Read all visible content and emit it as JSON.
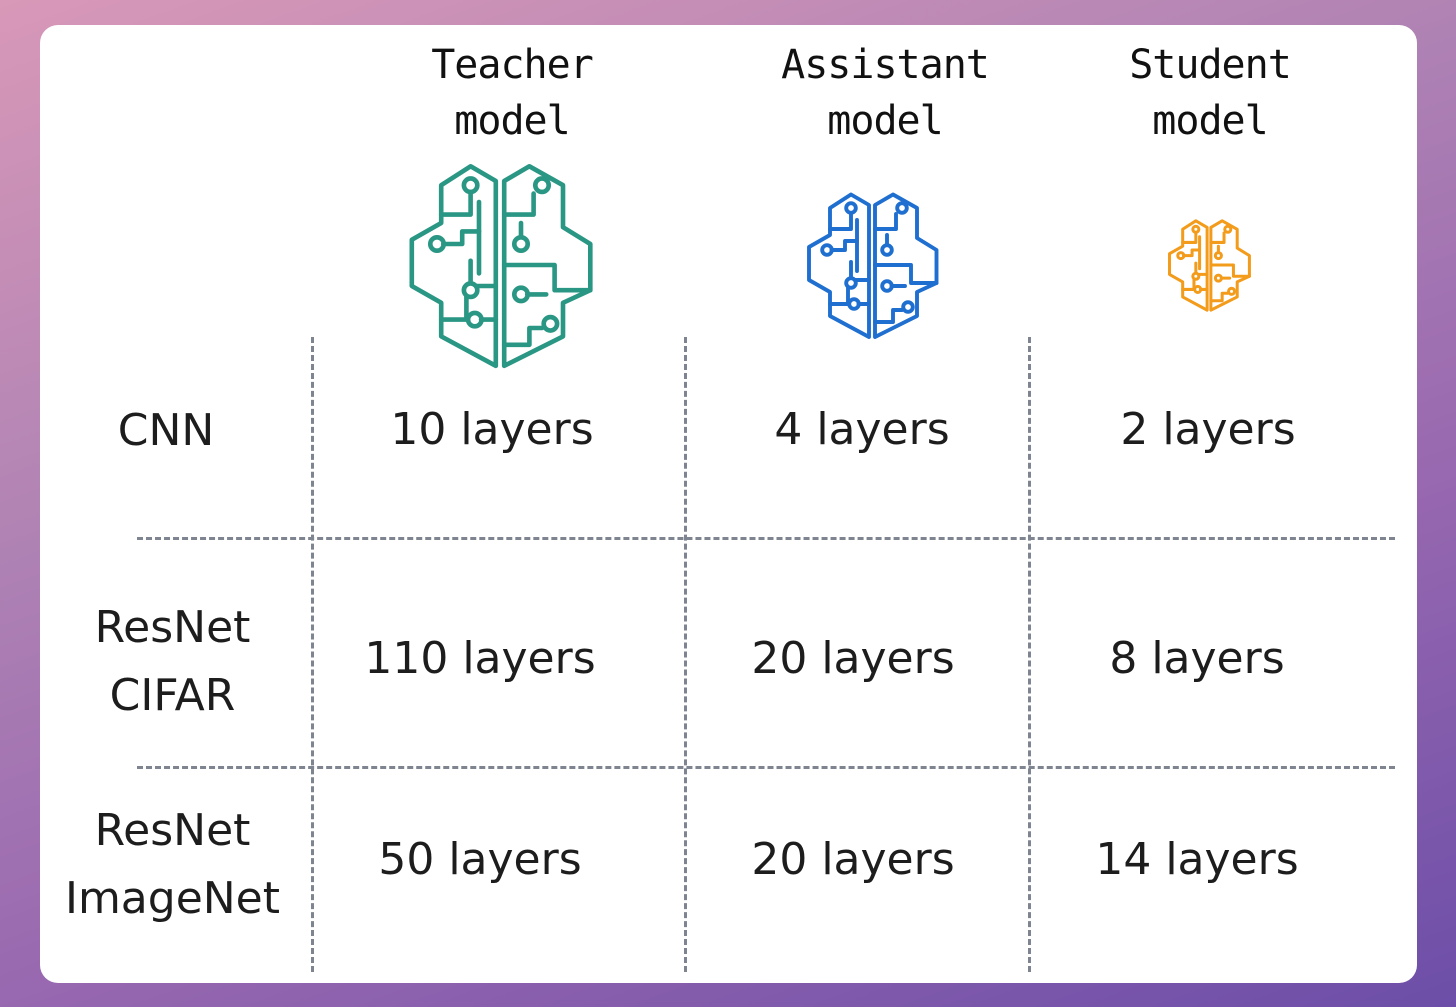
{
  "columns": [
    {
      "line1": "Teacher",
      "line2": "model",
      "icon": "brain-circuit-icon",
      "color": "#2a9684"
    },
    {
      "line1": "Assistant",
      "line2": "model",
      "icon": "brain-circuit-icon",
      "color": "#1f6fd0"
    },
    {
      "line1": "Student",
      "line2": "model",
      "icon": "brain-circuit-icon",
      "color": "#f39b1a"
    }
  ],
  "rows": [
    {
      "label_line1": "CNN",
      "label_line2": "",
      "teacher": "10 layers",
      "assistant": "4 layers",
      "student": "2 layers"
    },
    {
      "label_line1": "ResNet",
      "label_line2": "CIFAR",
      "teacher": "110 layers",
      "assistant": "20 layers",
      "student": "8 layers"
    },
    {
      "label_line1": "ResNet",
      "label_line2": "ImageNet",
      "teacher": "50 layers",
      "assistant": "20 layers",
      "student": "14 layers"
    }
  ]
}
